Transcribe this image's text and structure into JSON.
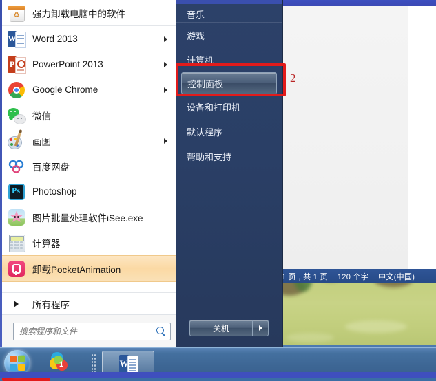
{
  "desktop": {
    "wallpaper_top_color": "#3d4fbf",
    "wallpaper_color": "#3b6aa0",
    "grass_color": "#c6d182"
  },
  "word_window": {
    "status_bar": {
      "page_info": "1 页 , 共 1 页",
      "word_count": "120 个字",
      "language": "中文(中国)"
    }
  },
  "start_menu": {
    "programs": [
      {
        "label": "强力卸载电脑中的软件",
        "icon": "uninstall-bin-icon",
        "arrow": false,
        "highlight": false,
        "separator": true
      },
      {
        "label": "Word 2013",
        "icon": "word-icon",
        "arrow": true,
        "highlight": false,
        "separator": false
      },
      {
        "label": "PowerPoint 2013",
        "icon": "powerpoint-icon",
        "arrow": true,
        "highlight": false,
        "separator": false
      },
      {
        "label": "Google Chrome",
        "icon": "chrome-icon",
        "arrow": true,
        "highlight": false,
        "separator": false
      },
      {
        "label": "微信",
        "icon": "wechat-icon",
        "arrow": false,
        "highlight": false,
        "separator": false
      },
      {
        "label": "画图",
        "icon": "paint-icon",
        "arrow": true,
        "highlight": false,
        "separator": false
      },
      {
        "label": "百度网盘",
        "icon": "baidu-netdisk-icon",
        "arrow": false,
        "highlight": false,
        "separator": false
      },
      {
        "label": "Photoshop",
        "icon": "photoshop-icon",
        "arrow": false,
        "highlight": false,
        "separator": false
      },
      {
        "label": "图片批量处理软件iSee.exe",
        "icon": "isee-icon",
        "arrow": false,
        "highlight": false,
        "separator": false
      },
      {
        "label": "计算器",
        "icon": "calculator-icon",
        "arrow": false,
        "highlight": false,
        "separator": false
      },
      {
        "label": "卸载PocketAnimation",
        "icon": "pocketanimation-icon",
        "arrow": false,
        "highlight": true,
        "separator": false
      }
    ],
    "all_programs_label": "所有程序",
    "search": {
      "placeholder": "搜索程序和文件",
      "value": "",
      "icon": "search-icon"
    },
    "right_items": [
      {
        "label": "音乐",
        "hover": false,
        "divider": true
      },
      {
        "label": "游戏",
        "hover": false,
        "divider": false
      },
      {
        "label": "计算机",
        "hover": false,
        "divider": false
      },
      {
        "label": "控制面板",
        "hover": true,
        "divider": false
      },
      {
        "label": "设备和打印机",
        "hover": false,
        "divider": false
      },
      {
        "label": "默认程序",
        "hover": false,
        "divider": false
      },
      {
        "label": "帮助和支持",
        "hover": false,
        "divider": false
      }
    ],
    "shutdown_label": "关机"
  },
  "annotations": {
    "step_two_label": "2",
    "highlight_color": "#e21b1b",
    "label_color": "#b92525"
  },
  "taskbar": {
    "start_orb": "windows-start-orb-icon",
    "items": [
      {
        "name": "360-browser-icon",
        "label": ""
      },
      {
        "name": "word-taskbar-icon",
        "label": "W"
      }
    ]
  }
}
